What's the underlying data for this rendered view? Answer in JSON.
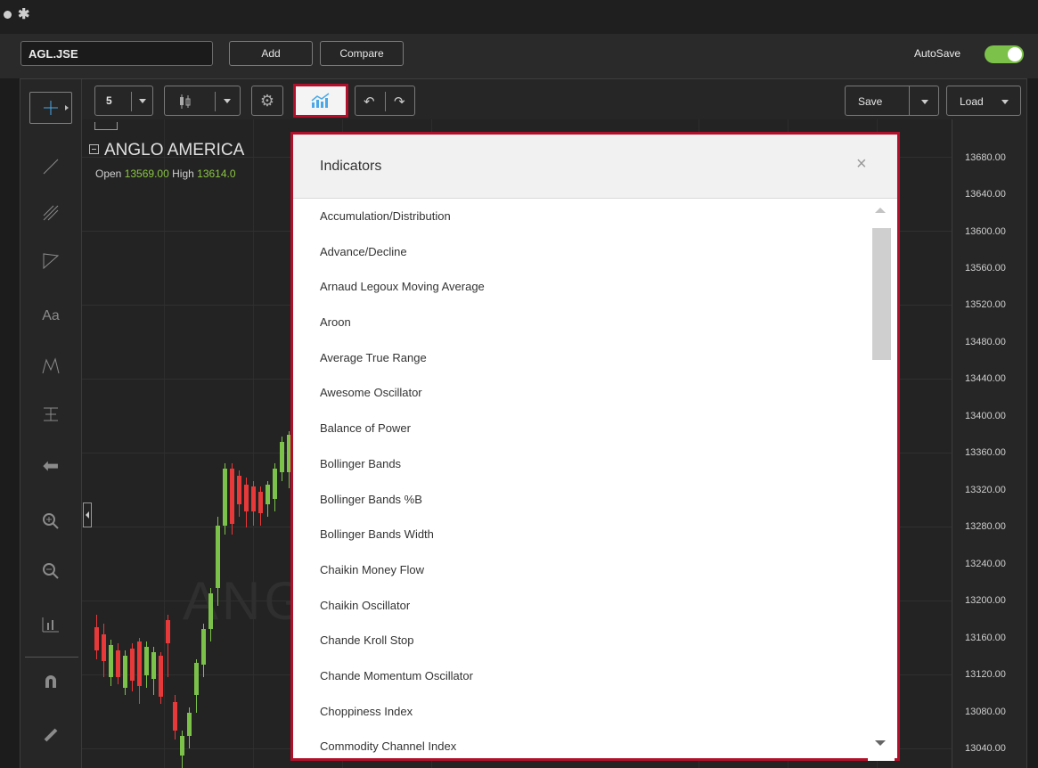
{
  "window": {
    "title_icons": [
      "status-dot-icon",
      "asterisk-icon"
    ]
  },
  "topbar": {
    "symbol": "AGL.JSE",
    "add_label": "Add",
    "compare_label": "Compare",
    "autosave_label": "AutoSave",
    "autosave_on": true
  },
  "toolbar": {
    "interval": "5",
    "save_label": "Save",
    "load_label": "Load"
  },
  "chart": {
    "title": "ANGLO AMERICA",
    "ohlc": {
      "open_label": "Open",
      "open_value": "13569.00",
      "high_label": "High",
      "high_value": "13614.0"
    },
    "watermark": "ANG",
    "yaxis_ticks": [
      "13680.00",
      "13640.00",
      "13600.00",
      "13560.00",
      "13520.00",
      "13480.00",
      "13440.00",
      "13400.00",
      "13360.00",
      "13320.00",
      "13280.00",
      "13240.00",
      "13200.00",
      "13160.00",
      "13120.00",
      "13080.00",
      "13040.00"
    ]
  },
  "indicators_modal": {
    "title": "Indicators",
    "close": "×",
    "items": [
      "Accumulation/Distribution",
      "Advance/Decline",
      "Arnaud Legoux Moving Average",
      "Aroon",
      "Average True Range",
      "Awesome Oscillator",
      "Balance of Power",
      "Bollinger Bands",
      "Bollinger Bands %B",
      "Bollinger Bands Width",
      "Chaikin Money Flow",
      "Chaikin Oscillator",
      "Chande Kroll Stop",
      "Chande Momentum Oscillator",
      "Choppiness Index",
      "Commodity Channel Index"
    ]
  },
  "colors": {
    "up": "#7cc24a",
    "down": "#e8393a",
    "highlight": "#b0102a",
    "accent": "#4aa8e8"
  },
  "left_tools": [
    "crosshair-icon",
    "trend-line-icon",
    "pitchfork-icon",
    "triangle-icon",
    "text-icon",
    "pattern-icon",
    "measure-icon",
    "arrow-left-icon",
    "zoom-in-icon",
    "zoom-out-icon",
    "bars-icon",
    "magnet-icon",
    "pencil-icon"
  ]
}
